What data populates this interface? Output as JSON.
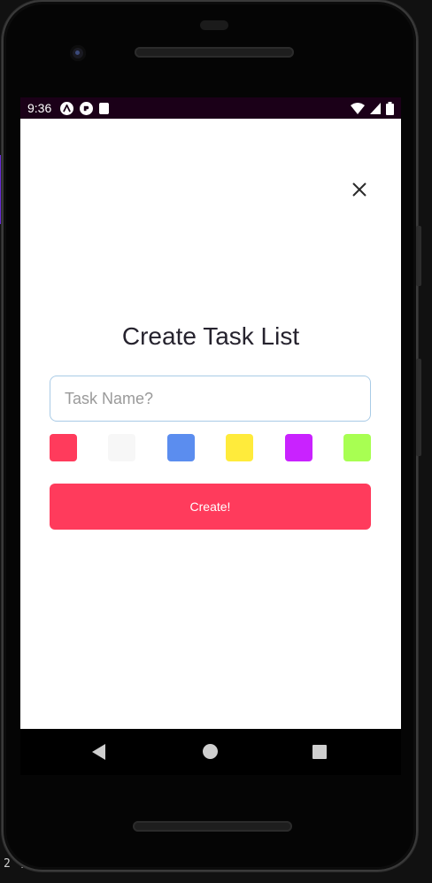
{
  "status_bar": {
    "time": "9:36",
    "left_icons": [
      "launcher-icon",
      "react-icon",
      "sd-card-icon"
    ],
    "right_icons": [
      "wifi-icon",
      "signal-icon",
      "battery-icon"
    ]
  },
  "screen": {
    "title": "Create Task List",
    "task_input": {
      "placeholder": "Task Name?",
      "value": ""
    },
    "colors": [
      {
        "name": "red",
        "hex": "#ff3b5c"
      },
      {
        "name": "white",
        "hex": "#f7f7f7"
      },
      {
        "name": "blue",
        "hex": "#5b8def"
      },
      {
        "name": "yellow",
        "hex": "#ffeb3b"
      },
      {
        "name": "purple",
        "hex": "#c922ff"
      },
      {
        "name": "green",
        "hex": "#a8ff52"
      }
    ],
    "create_label": "Create!",
    "close_icon": "close-icon"
  },
  "nav_bar": {
    "icons": [
      "back-icon",
      "home-icon",
      "recents-icon"
    ]
  },
  "background": {
    "bottom_text": "2 /"
  },
  "theme": {
    "accent": "#ff3b5c",
    "status_bar_bg": "#1b0018",
    "input_border": "#a9cbe6"
  }
}
